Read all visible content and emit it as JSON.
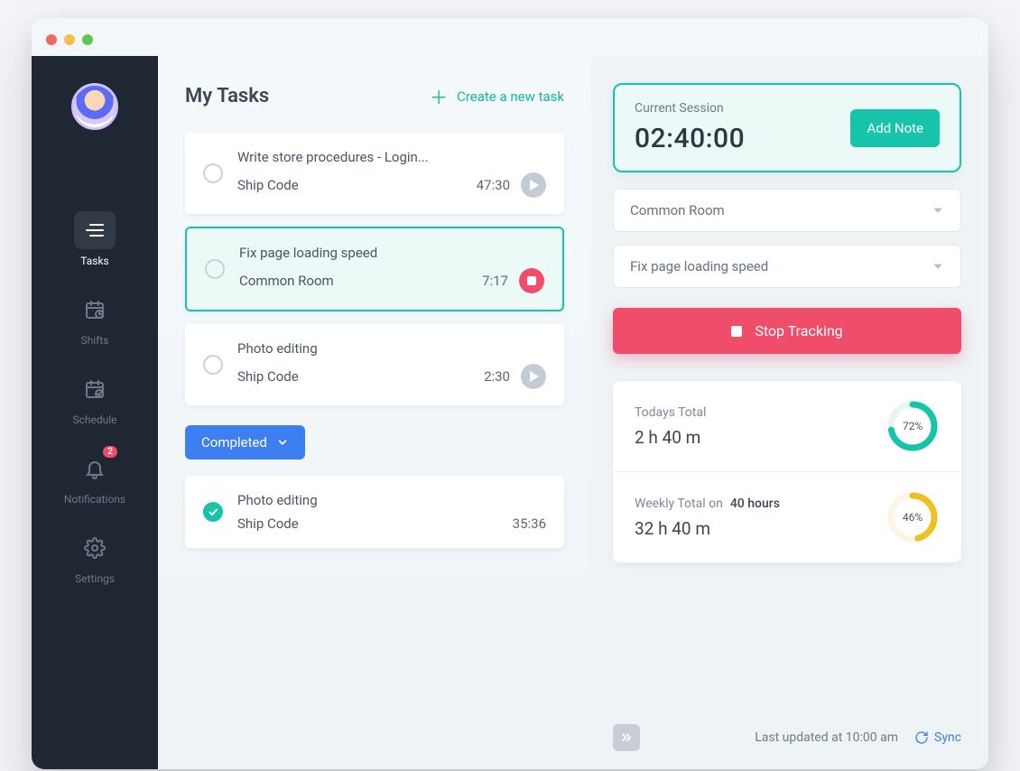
{
  "sidebar": {
    "items": [
      {
        "label": "Tasks"
      },
      {
        "label": "Shifts"
      },
      {
        "label": "Schedule"
      },
      {
        "label": "Notifications",
        "badge": "2"
      },
      {
        "label": "Settings"
      }
    ]
  },
  "tasks": {
    "title": "My Tasks",
    "create_label": "Create a new task",
    "list": [
      {
        "name": "Write store procedures - Login...",
        "project": "Ship Code",
        "time": "47:30"
      },
      {
        "name": "Fix page loading speed",
        "project": "Common Room",
        "time": "7:17"
      },
      {
        "name": "Photo editing",
        "project": "Ship Code",
        "time": "2:30"
      }
    ],
    "completed_label": "Completed",
    "completed": [
      {
        "name": "Photo editing",
        "project": "Ship Code",
        "time": "35:36"
      }
    ]
  },
  "session": {
    "label": "Current Session",
    "time": "02:40:00",
    "add_note_label": "Add Note",
    "project_select": "Common Room",
    "task_select": "Fix page loading speed",
    "stop_label": "Stop Tracking"
  },
  "totals": {
    "today_label": "Todays Total",
    "today_value": "2 h 40 m",
    "today_pct": "72%",
    "weekly_label": "Weekly Total on",
    "weekly_cap": "40 hours",
    "weekly_value": "32 h 40 m",
    "weekly_pct": "46%"
  },
  "footer": {
    "last_updated": "Last updated at 10:00 am",
    "sync_label": "Sync"
  },
  "colors": {
    "primary": "#17c4a9",
    "danger": "#ef4d6a",
    "accent_blue": "#3d7ef0",
    "accent_yellow": "#f0c020"
  }
}
